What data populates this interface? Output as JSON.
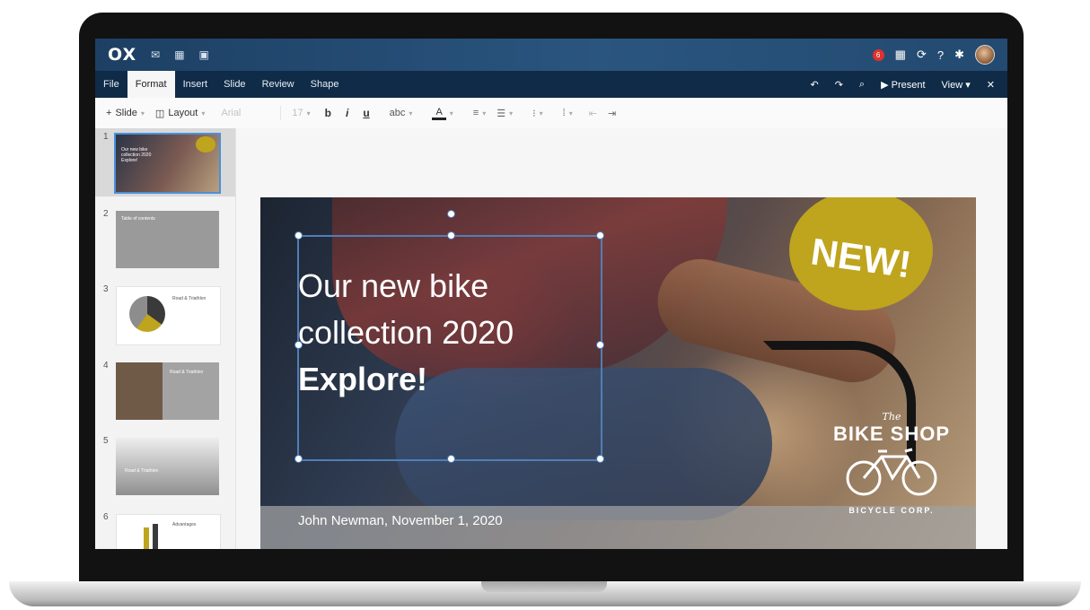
{
  "app": {
    "logo": "OX",
    "notification_count": "6"
  },
  "menu": {
    "items": [
      "File",
      "Format",
      "Insert",
      "Slide",
      "Review",
      "Shape"
    ],
    "active": "Format",
    "present_label": "Present",
    "view_label": "View"
  },
  "toolbar": {
    "slide_label": "Slide",
    "layout_label": "Layout",
    "font_family": "Arial",
    "font_size": "17",
    "bold": "b",
    "italic": "i",
    "underline": "u",
    "abc": "abc"
  },
  "thumbnails": [
    {
      "number": "1",
      "text": "Our new bike collection 2020 Explore!"
    },
    {
      "number": "2",
      "text": "Table of contents"
    },
    {
      "number": "3",
      "text": "Road & Triathlon"
    },
    {
      "number": "4",
      "text": "Road & Triathlon"
    },
    {
      "number": "5",
      "text": "Road & Triathlon"
    },
    {
      "number": "6",
      "text": "Advantages"
    }
  ],
  "slide": {
    "title_line1": "Our new bike",
    "title_line2": "collection 2020",
    "title_line3": "Explore!",
    "badge": "NEW!",
    "footer": "John Newman, November 1, 2020",
    "brand_the": "The",
    "brand_name": "BIKE SHOP",
    "brand_corp": "BICYCLE CORP."
  },
  "icons": {
    "top": [
      "mail-icon",
      "calendar-icon",
      "contacts-icon",
      "apps-grid-icon",
      "refresh-icon",
      "help-icon",
      "settings-icon"
    ],
    "menu_right": [
      "undo-icon",
      "redo-icon",
      "search-icon",
      "present-icon",
      "close-icon"
    ]
  },
  "colors": {
    "topbar": "#234a70",
    "menubar": "#0f2b47",
    "badge_accent": "#bfa41d",
    "selection": "#4f7fb8"
  }
}
